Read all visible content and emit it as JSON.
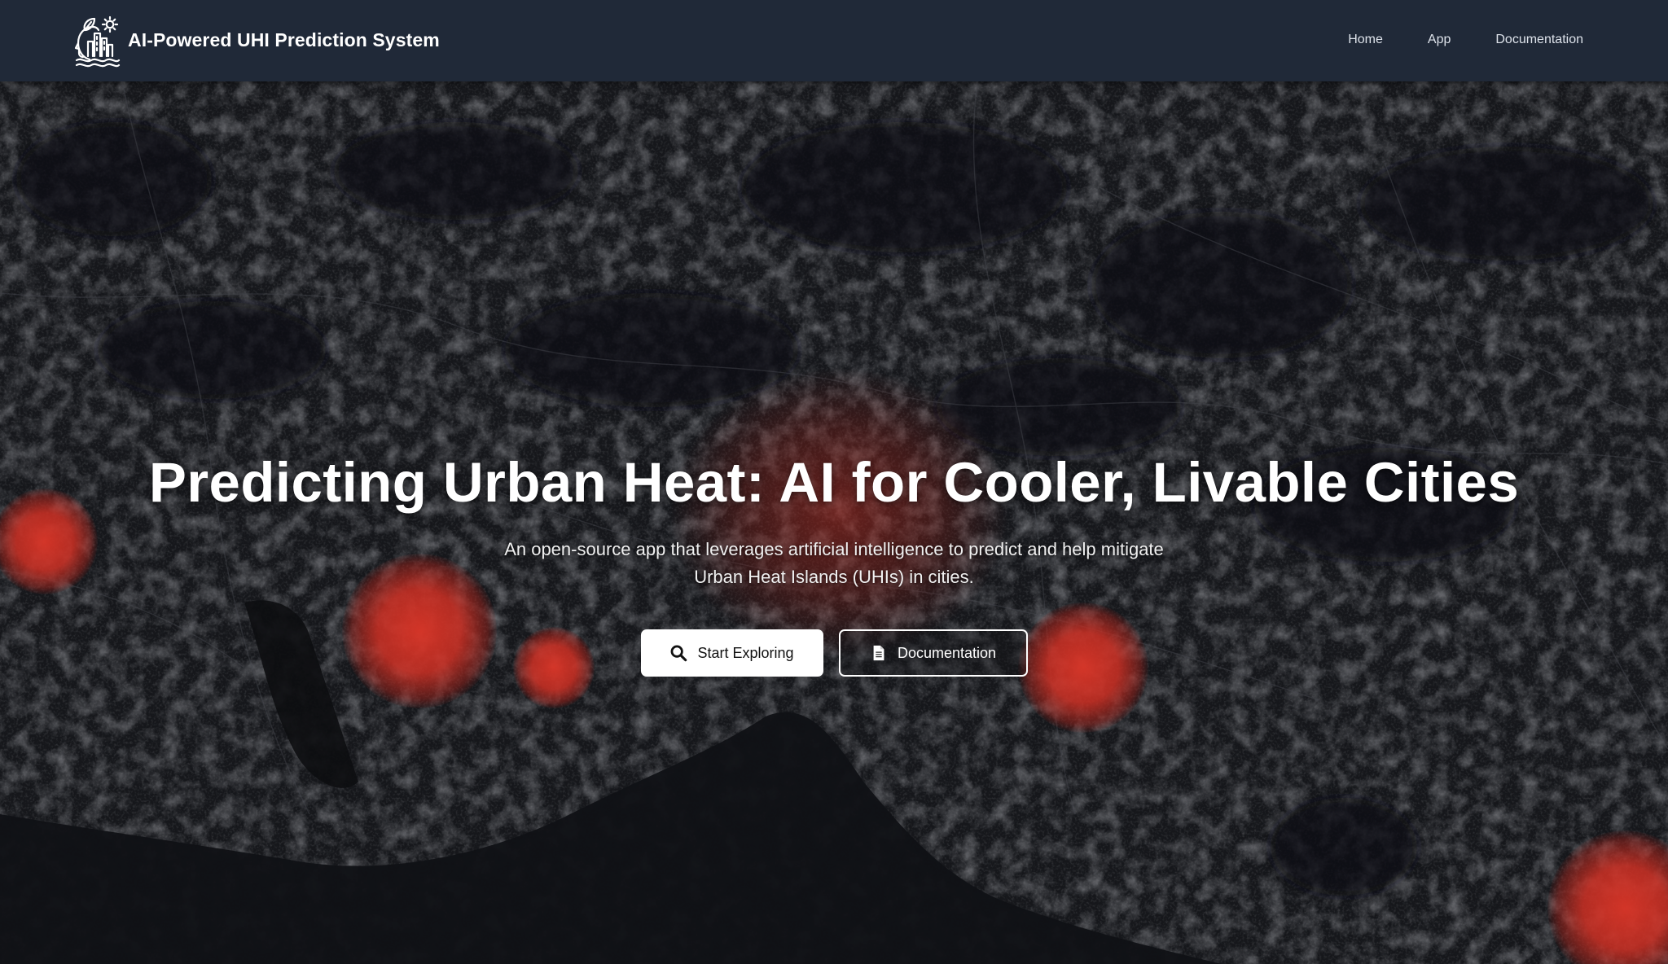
{
  "header": {
    "brand_title": "AI-Powered UHI Prediction System",
    "logo_icon": "head-city-sun-logo",
    "nav": [
      {
        "label": "Home"
      },
      {
        "label": "App"
      },
      {
        "label": "Documentation"
      }
    ]
  },
  "hero": {
    "title": "Predicting Urban Heat: AI for Cooler, Livable Cities",
    "subtitle": "An open-source app that leverages artificial intelligence to predict and help mitigate Urban Heat Islands (UHIs) in cities.",
    "primary_button": {
      "label": "Start Exploring",
      "icon": "search-icon"
    },
    "secondary_button": {
      "label": "Documentation",
      "icon": "document-icon"
    },
    "background": "dark-satellite-map-with-heat-hotspots"
  },
  "colors": {
    "header_bg": "#202938",
    "hotspot": "#d8382a",
    "map_dark": "#17191d",
    "button_primary_bg": "#ffffff"
  }
}
